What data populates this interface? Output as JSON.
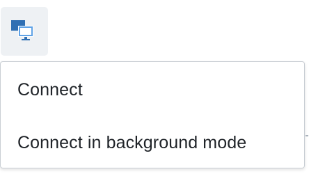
{
  "toolbar": {
    "connect_button_icon": "remote-desktop-icon"
  },
  "menu": {
    "items": [
      {
        "label": "Connect"
      },
      {
        "label": "Connect in background mode"
      }
    ]
  },
  "colors": {
    "icon_blue": "#2f6fb3",
    "icon_light_blue": "#5fa2e6",
    "button_bg": "#eef1f4",
    "menu_border": "#c9ced4",
    "text": "#1f2328"
  }
}
